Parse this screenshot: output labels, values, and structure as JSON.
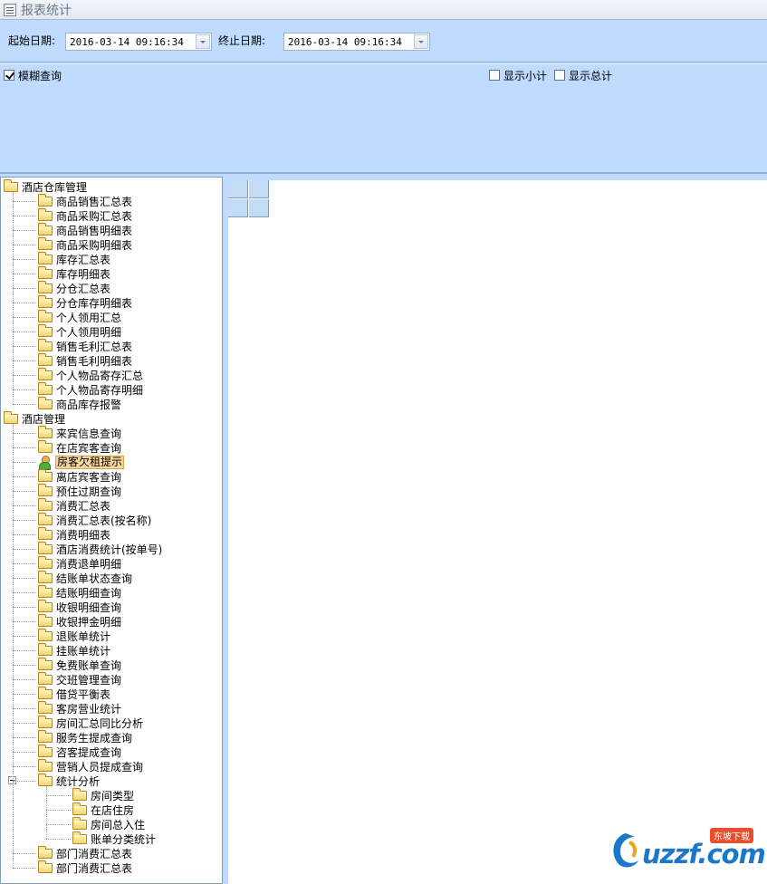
{
  "window": {
    "title": "报表统计"
  },
  "filters": {
    "start_label": "起始日期:",
    "start_value": "2016-03-14 09:16:34",
    "end_label": "终止日期:",
    "end_value": "2016-03-14 09:16:34"
  },
  "options": {
    "fuzzy": {
      "label": "模糊查询",
      "checked": true
    },
    "subtotal": {
      "label": "显示小计",
      "checked": false
    },
    "total": {
      "label": "显示总计",
      "checked": false
    }
  },
  "tree": {
    "selected": "房客欠租提示",
    "groups": [
      {
        "label": "酒店仓库管理",
        "items": [
          "商品销售汇总表",
          "商品采购汇总表",
          "商品销售明细表",
          "商品采购明细表",
          "库存汇总表",
          "库存明细表",
          "分仓汇总表",
          "分仓库存明细表",
          "个人领用汇总",
          "个人领用明细",
          "销售毛利汇总表",
          "销售毛利明细表",
          "个人物品寄存汇总",
          "个人物品寄存明细",
          "商品库存报警"
        ]
      },
      {
        "label": "酒店管理",
        "items": [
          "来宾信息查询",
          "在店宾客查询",
          "房客欠租提示",
          "离店宾客查询",
          "预住过期查询",
          "消费汇总表",
          "消费汇总表(按名称)",
          "消费明细表",
          "酒店消费统计(按单号)",
          "消费退单明细",
          "结账单状态查询",
          "结账明细查询",
          "收银明细查询",
          "收银押金明细",
          "退账单统计",
          "挂账单统计",
          "免费账单查询",
          "交班管理查询",
          "借贷平衡表",
          "客房营业统计",
          "房间汇总同比分析",
          "服务生提成查询",
          "咨客提成查询",
          "营销人员提成查询"
        ],
        "subgroup": {
          "label": "统计分析",
          "items": [
            "房间类型",
            "在店住房",
            "房间总入住",
            "账单分类统计"
          ]
        },
        "tail": [
          "部门消费汇总表",
          "部门消费汇总表"
        ]
      }
    ]
  },
  "watermark": {
    "text": "uzzf.com",
    "badge": "东坡下载"
  },
  "icons": {
    "title": "report-window-icon",
    "folder": "folder-icon",
    "selected": "guest-icon",
    "dropdown": "chevron-down-icon"
  },
  "colors": {
    "panel": "#bfdbff",
    "selection": "#f8d8a0",
    "grid_header": "#c5dcf6"
  }
}
